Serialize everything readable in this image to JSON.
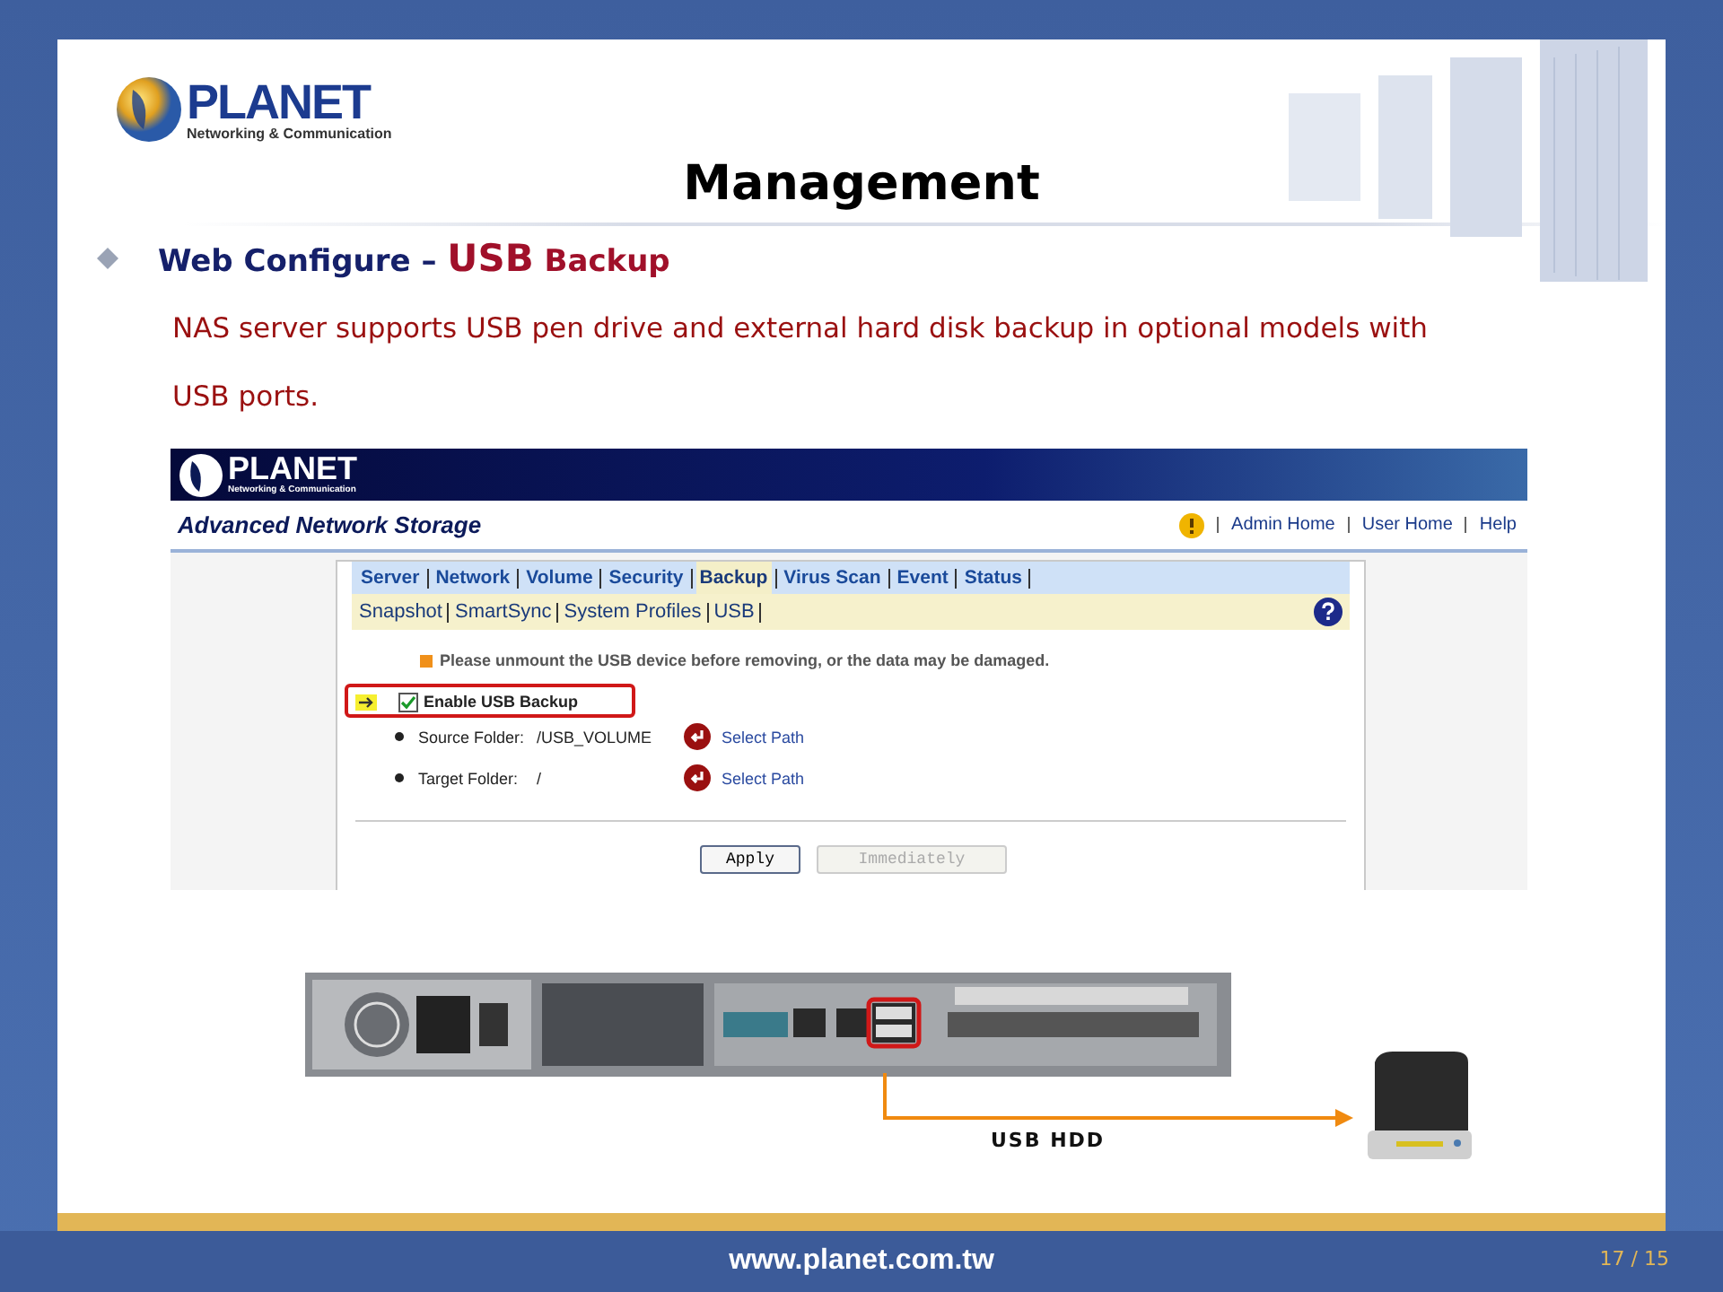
{
  "logo": {
    "name": "PLANET",
    "tagline": "Networking & Communication"
  },
  "title": "Management",
  "heading": {
    "lead": "Web Configure",
    "dash": "–",
    "accent": "USB",
    "rest": "Backup"
  },
  "description": "NAS server supports USB pen drive and external hard disk backup in optional models with USB ports.",
  "app": {
    "logo": {
      "name": "PLANET",
      "tagline": "Networking & Communication"
    },
    "product": "Advanced Network Storage",
    "links": [
      "Admin Home",
      "User Home",
      "Help"
    ],
    "tabs": [
      {
        "label": "Server",
        "selected": false
      },
      {
        "label": "Network",
        "selected": false
      },
      {
        "label": "Volume",
        "selected": false
      },
      {
        "label": "Security",
        "selected": false
      },
      {
        "label": "Backup",
        "selected": true
      },
      {
        "label": "Virus Scan",
        "selected": false
      },
      {
        "label": "Event",
        "selected": false
      },
      {
        "label": "Status",
        "selected": false
      }
    ],
    "subtabs": [
      "Snapshot",
      "SmartSync",
      "System Profiles",
      "USB"
    ],
    "notice": "Please unmount the USB device before removing, or the data may be damaged.",
    "enable": {
      "label": "Enable USB Backup",
      "checked": true
    },
    "folders": [
      {
        "label": "Source Folder:",
        "value": "/USB_VOLUME",
        "action": "Select Path"
      },
      {
        "label": "Target Folder:",
        "value": "/",
        "action": "Select Path"
      }
    ],
    "buttons": [
      {
        "label": "Apply",
        "disabled": false
      },
      {
        "label": "Immediately",
        "disabled": true
      }
    ]
  },
  "diagram": {
    "label": "USB HDD"
  },
  "footer": {
    "url": "www.planet.com.tw",
    "page": "17 / 15"
  }
}
